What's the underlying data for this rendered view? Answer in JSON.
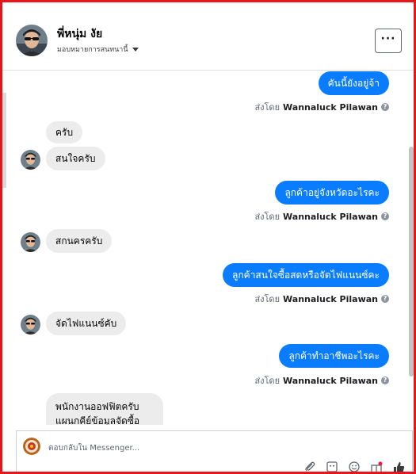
{
  "contact": {
    "name": "พี่หนุ่ม งัย",
    "subtitle": "มอบหมายการสนทนานี้",
    "more_label": "···"
  },
  "messages": [
    {
      "dir": "out",
      "text": "คันนี้ยังอยู่จ้า",
      "sent_prefix": "ส่งโดย",
      "sender": "Wannaluck Pilawan"
    },
    {
      "dir": "in",
      "text": "ครับ"
    },
    {
      "dir": "in",
      "text": "สนใจครับ"
    },
    {
      "dir": "out",
      "text": "ลูกค้าอยู่จังหวัดอะไรคะ",
      "sent_prefix": "ส่งโดย",
      "sender": "Wannaluck Pilawan"
    },
    {
      "dir": "in",
      "text": "สกนครครับ"
    },
    {
      "dir": "out",
      "text": "ลูกค้าสนใจซื้อสดหรือจัดไฟแนนซ์คะ",
      "sent_prefix": "ส่งโดย",
      "sender": "Wannaluck Pilawan"
    },
    {
      "dir": "in",
      "text": "จัดไฟแนนซ์คับ"
    },
    {
      "dir": "out",
      "text": "ลูกค้าทำอาชีพอะไรคะ",
      "sent_prefix": "ส่งโดย",
      "sender": "Wannaluck Pilawan"
    },
    {
      "dir": "in",
      "text": "พนักงานออฟฟิตครับ แผนกคีย์ข้อมูลจัดซื้อครับ"
    }
  ],
  "composer": {
    "placeholder": "ตอบกลับใน Messenger..."
  },
  "icons": [
    "more-icon",
    "caret-down-icon",
    "help-icon",
    "attach-icon",
    "gif-icon",
    "emoji-icon",
    "gift-icon",
    "like-icon"
  ],
  "colors": {
    "outgoing_bubble": "#0a7cff",
    "incoming_bubble": "#ececec",
    "frame": "#e8141c"
  }
}
